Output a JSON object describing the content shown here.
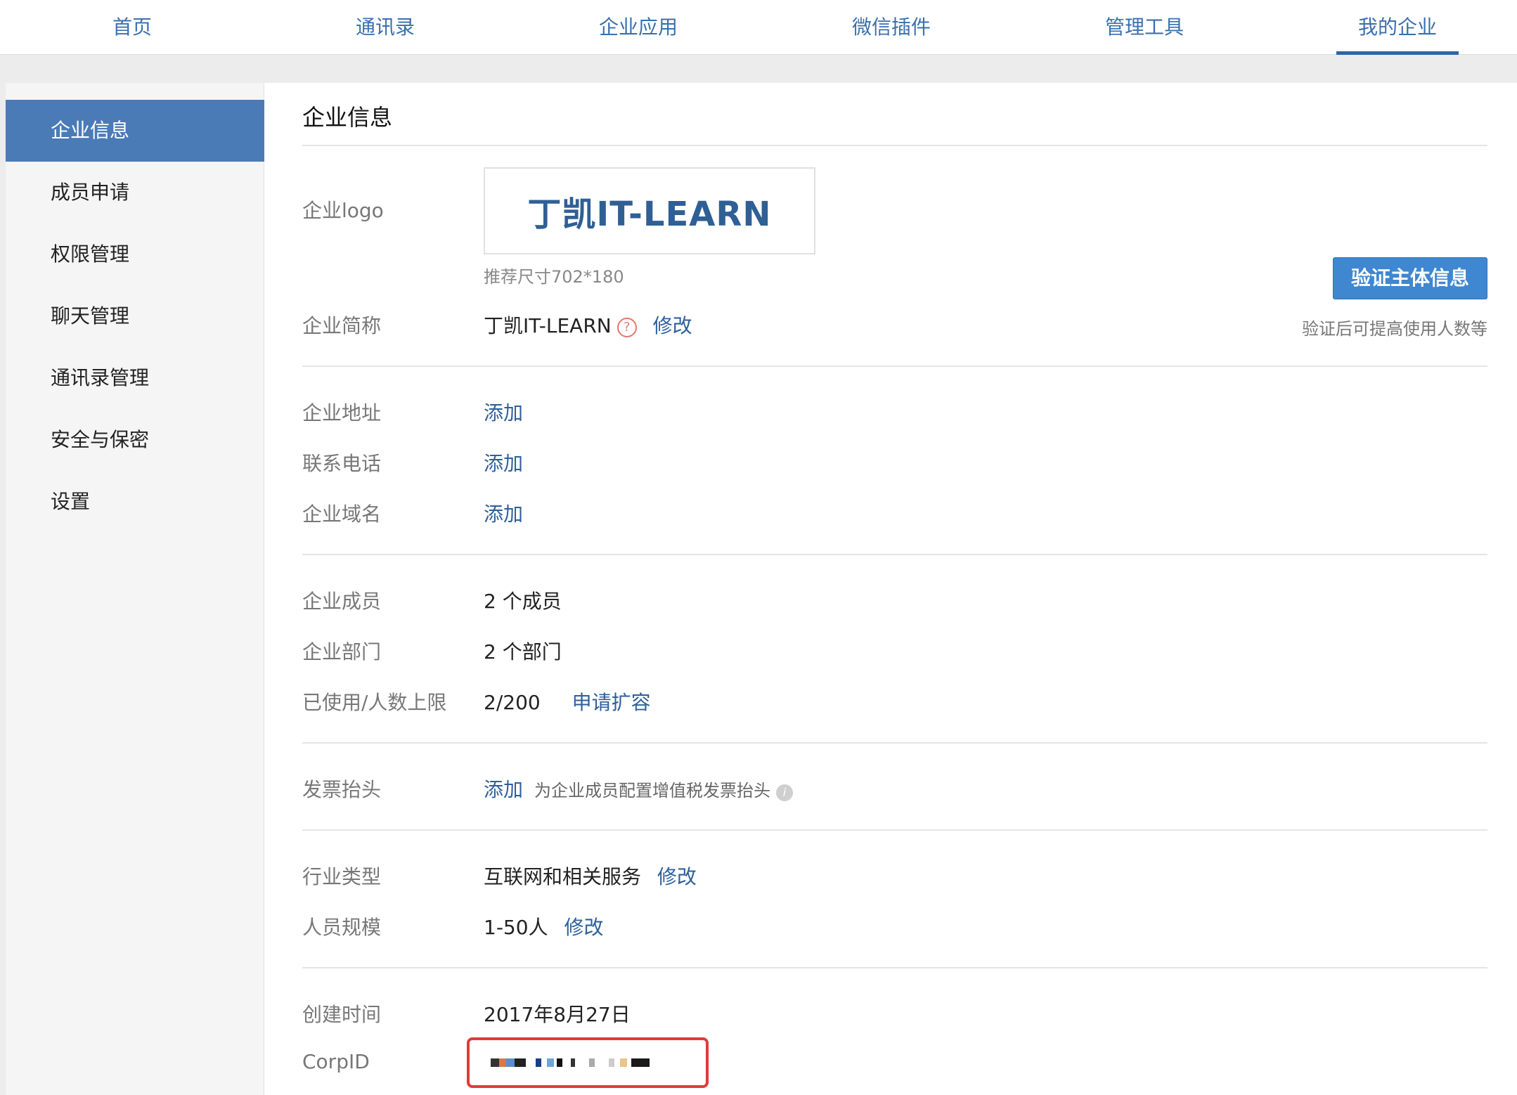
{
  "nav": {
    "items": [
      "首页",
      "通讯录",
      "企业应用",
      "微信插件",
      "管理工具",
      "我的企业"
    ],
    "active": "我的企业"
  },
  "sidebar": {
    "items": [
      "企业信息",
      "成员申请",
      "权限管理",
      "聊天管理",
      "通讯录管理",
      "安全与保密",
      "设置"
    ],
    "active": "企业信息"
  },
  "main": {
    "title": "企业信息",
    "logo": {
      "label": "企业logo",
      "text": "丁凯IT-LEARN",
      "hint": "推荐尺寸702*180"
    },
    "verify": {
      "button": "验证主体信息",
      "tip": "验证后可提高使用人数等"
    },
    "short_name": {
      "label": "企业简称",
      "value": "丁凯IT-LEARN",
      "action": "修改"
    },
    "address": {
      "label": "企业地址",
      "action": "添加"
    },
    "phone": {
      "label": "联系电话",
      "action": "添加"
    },
    "domain": {
      "label": "企业域名",
      "action": "添加"
    },
    "members": {
      "label": "企业成员",
      "value": "2 个成员"
    },
    "departments": {
      "label": "企业部门",
      "value": "2 个部门"
    },
    "limit": {
      "label": "已使用/人数上限",
      "value": "2/200",
      "action": "申请扩容"
    },
    "invoice": {
      "label": "发票抬头",
      "action": "添加",
      "desc": "为企业成员配置增值税发票抬头"
    },
    "industry": {
      "label": "行业类型",
      "value": "互联网和相关服务",
      "action": "修改"
    },
    "scale": {
      "label": "人员规模",
      "value": "1-50人",
      "action": "修改"
    },
    "created": {
      "label": "创建时间",
      "value": "2017年8月27日"
    },
    "corpid": {
      "label": "CorpID"
    }
  },
  "colors": {
    "accent": "#2d5f9c",
    "sidebar_active": "#4a7bb7",
    "verify_button": "#3f87d0",
    "highlight_border": "#e23a3a"
  }
}
